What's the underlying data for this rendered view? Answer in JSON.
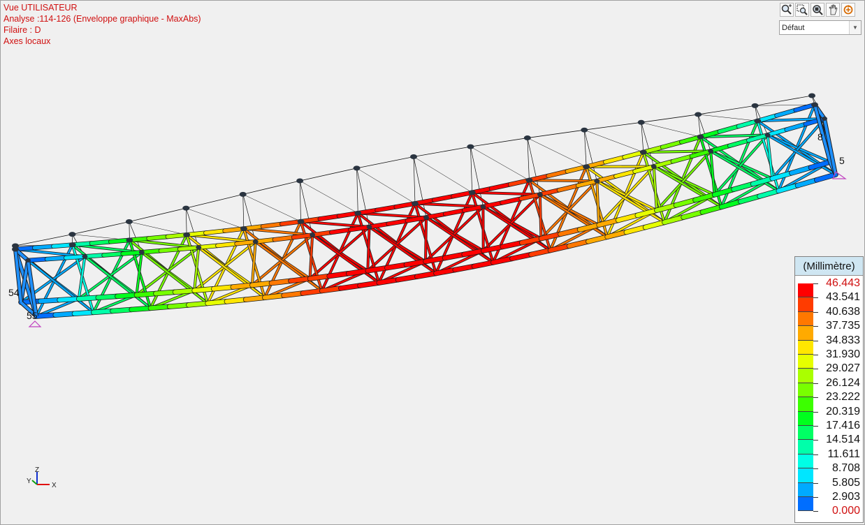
{
  "header": {
    "view_label": "Vue UTILISATEUR",
    "analysis_label": "Analyse :114-126 (Enveloppe graphique - MaxAbs)",
    "wire_label": "Filaire : D",
    "axes_label": "Axes locaux"
  },
  "toolbar": {
    "buttons": [
      "zoom-in-icon",
      "zoom-window-icon",
      "zoom-extents-icon",
      "pan-icon",
      "rotate-icon"
    ],
    "view_select_value": "Défaut"
  },
  "model": {
    "node_labels": [
      "54",
      "55",
      "5",
      "8"
    ]
  },
  "legend": {
    "title": "(Millimètre)",
    "values": [
      "46.443",
      "43.541",
      "40.638",
      "37.735",
      "34.833",
      "31.930",
      "29.027",
      "26.124",
      "23.222",
      "20.319",
      "17.416",
      "14.514",
      "11.611",
      "8.708",
      "5.805",
      "2.903",
      "0.000"
    ],
    "colors": [
      "#ff0000",
      "#ff3c00",
      "#ff7800",
      "#ffaa00",
      "#ffe600",
      "#e6ff00",
      "#aaff00",
      "#78ff00",
      "#3cff00",
      "#00ff1e",
      "#00ff64",
      "#00ffaa",
      "#00ffe6",
      "#00e6ff",
      "#00aaff",
      "#006eff"
    ],
    "max_color": "#d01010"
  },
  "axes_triad": {
    "z": "Z",
    "y": "Y",
    "x": "X"
  }
}
